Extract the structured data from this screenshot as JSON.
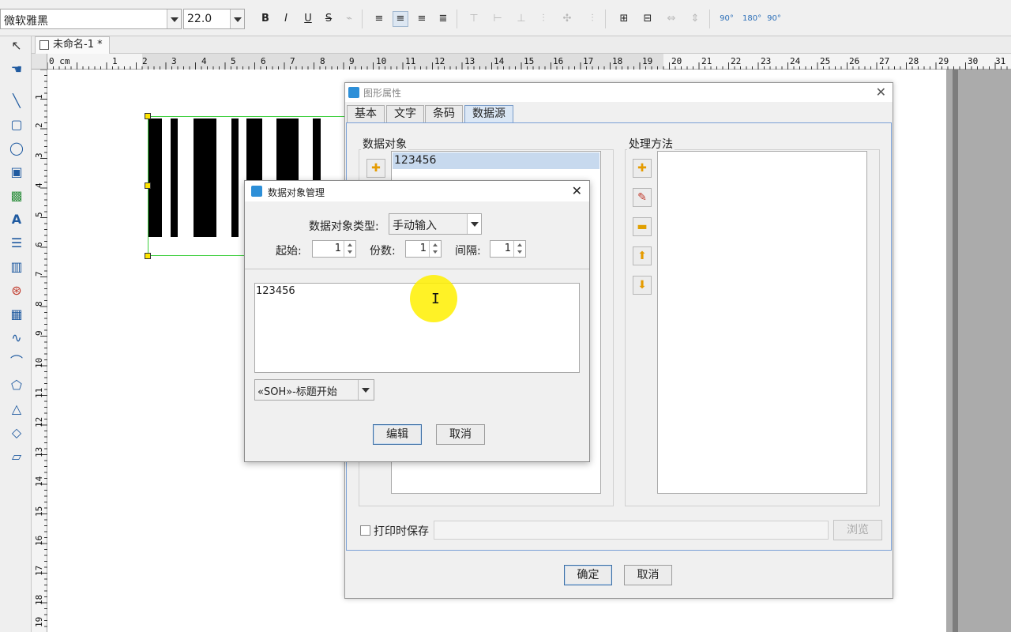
{
  "toolbar": {
    "font_name": "微软雅黑",
    "font_size": "22.0",
    "bold_label": "B",
    "italic_label": "I",
    "underline_label": "U",
    "strike_label": "S",
    "rotate_labels": [
      "90°",
      "180°",
      "90°"
    ]
  },
  "document": {
    "tab_title": "未命名-1 *"
  },
  "rulers": {
    "horizontal": [
      "0 cm",
      "1",
      "2",
      "3",
      "4",
      "5",
      "6",
      "7",
      "8",
      "9",
      "10",
      "11",
      "12",
      "13",
      "14",
      "15",
      "16",
      "17",
      "18",
      "19",
      "20",
      "21",
      "22",
      "23",
      "24",
      "25",
      "26",
      "27",
      "28",
      "29",
      "30",
      "31"
    ],
    "vertical": [
      "1",
      "2",
      "3",
      "4",
      "5",
      "6",
      "7",
      "8",
      "9",
      "10",
      "11",
      "12",
      "13",
      "14",
      "15",
      "16",
      "17",
      "18",
      "19"
    ]
  },
  "property_dialog": {
    "title": "图形属性",
    "tabs": [
      {
        "label": "基本"
      },
      {
        "label": "文字"
      },
      {
        "label": "条码"
      },
      {
        "label": "数据源"
      }
    ],
    "active_tab": "数据源",
    "data_objects_label": "数据对象",
    "data_objects": [
      "123456"
    ],
    "processing_label": "处理方法",
    "save_on_print_label": "打印时保存",
    "browse_label": "浏览",
    "ok_label": "确定",
    "cancel_label": "取消"
  },
  "manager_dialog": {
    "title": "数据对象管理",
    "type_label": "数据对象类型:",
    "type_value": "手动输入",
    "start_label": "起始:",
    "start_value": "1",
    "copies_label": "份数:",
    "copies_value": "1",
    "interval_label": "间隔:",
    "interval_value": "1",
    "content": "123456",
    "control_char_value": "«SOH»-标题开始",
    "edit_label": "编辑",
    "cancel_label": "取消"
  },
  "colors": {
    "selection_border": "#3fcf3f",
    "handle": "#ffe500",
    "cursor_highlight": "#fff000",
    "tab_active": "#dbe7f5"
  }
}
